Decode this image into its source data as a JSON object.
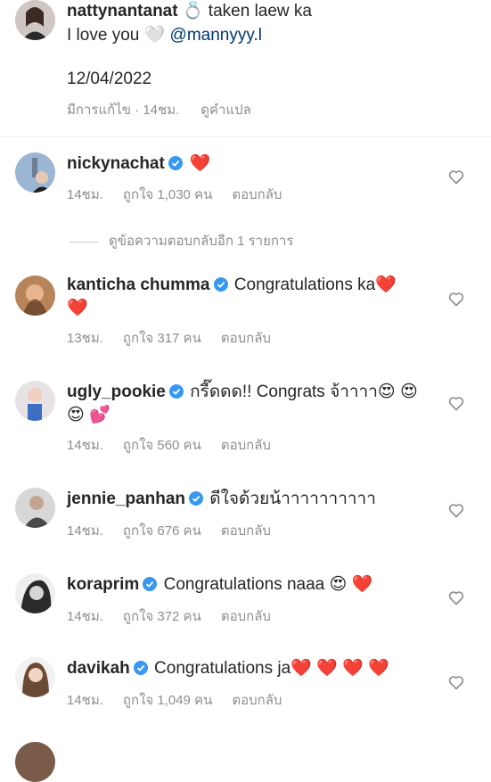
{
  "caption": {
    "username": "nattynantanat",
    "ring_emoji": "💍",
    "text1": " taken laew ka",
    "love_text": "I love you ",
    "white_heart": "🤍",
    "mention": " @mannyyy.l",
    "date": "12/04/2022",
    "edited": "มีการแก้ไข · 14ชม.",
    "translate": "ดูคำแปล"
  },
  "view_replies": "ดูข้อความตอบกลับอีก 1 รายการ",
  "comments": [
    {
      "username": "nickynachat",
      "text": " ❤️",
      "time": "14ชม.",
      "likes": "ถูกใจ 1,030 คน",
      "reply": "ตอบกลับ"
    },
    {
      "username": "kanticha chumma",
      "text": " Congratulations ka❤️ ❤️",
      "time": "13ชม.",
      "likes": "ถูกใจ 317 คน",
      "reply": "ตอบกลับ"
    },
    {
      "username": "ugly_pookie",
      "text": " กรี๊ดดด!! Congrats จ้าาาา😍 😍 😍 💕",
      "time": "14ชม.",
      "likes": "ถูกใจ 560 คน",
      "reply": "ตอบกลับ"
    },
    {
      "username": "jennie_panhan",
      "text": " ดีใจด้วยน้าาาาาาาาาา",
      "time": "14ชม.",
      "likes": "ถูกใจ 676 คน",
      "reply": "ตอบกลับ"
    },
    {
      "username": "koraprim",
      "text": " Congratulations naaa 😍 ❤️",
      "time": "14ชม.",
      "likes": "ถูกใจ 372 คน",
      "reply": "ตอบกลับ"
    },
    {
      "username": "davikah",
      "text": " Congratulations ja❤️ ❤️ ❤️ ❤️",
      "time": "14ชม.",
      "likes": "ถูกใจ 1,049 คน",
      "reply": "ตอบกลับ"
    }
  ],
  "colors": {
    "verified": "#3897f0",
    "meta": "#8e8e8e",
    "mention": "#00376b",
    "heart": "#e0263c"
  }
}
